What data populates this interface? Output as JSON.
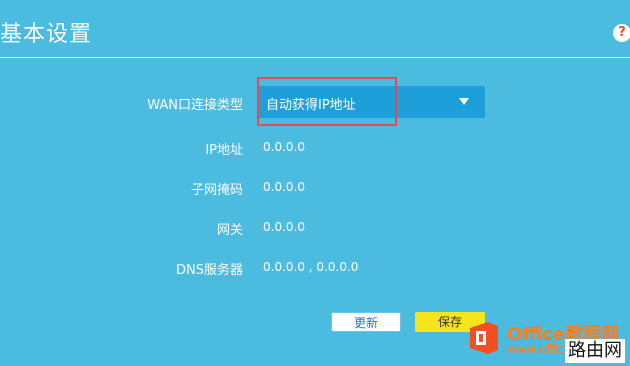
{
  "header": {
    "title": "基本设置",
    "help_label": "?"
  },
  "form": {
    "wan_type_label": "WAN口连接类型",
    "wan_type_value": "自动获得IP地址",
    "ip_label": "IP地址",
    "ip_value": "0.0.0.0",
    "mask_label": "子网掩码",
    "mask_value": "0.0.0.0",
    "gateway_label": "网关",
    "gateway_value": "0.0.0.0",
    "dns_label": "DNS服务器",
    "dns_value": "0.0.0.0 , 0.0.0.0"
  },
  "buttons": {
    "refresh_label": "更新",
    "save_label": "保存"
  },
  "watermark": {
    "brand": "Office教程网",
    "url": "www.office26.com",
    "site": "路由网"
  },
  "colors": {
    "background": "#4bbbe0",
    "select_bg": "#1e9fda",
    "highlight_box": "#e64a57",
    "save_button": "#f6e51d"
  }
}
